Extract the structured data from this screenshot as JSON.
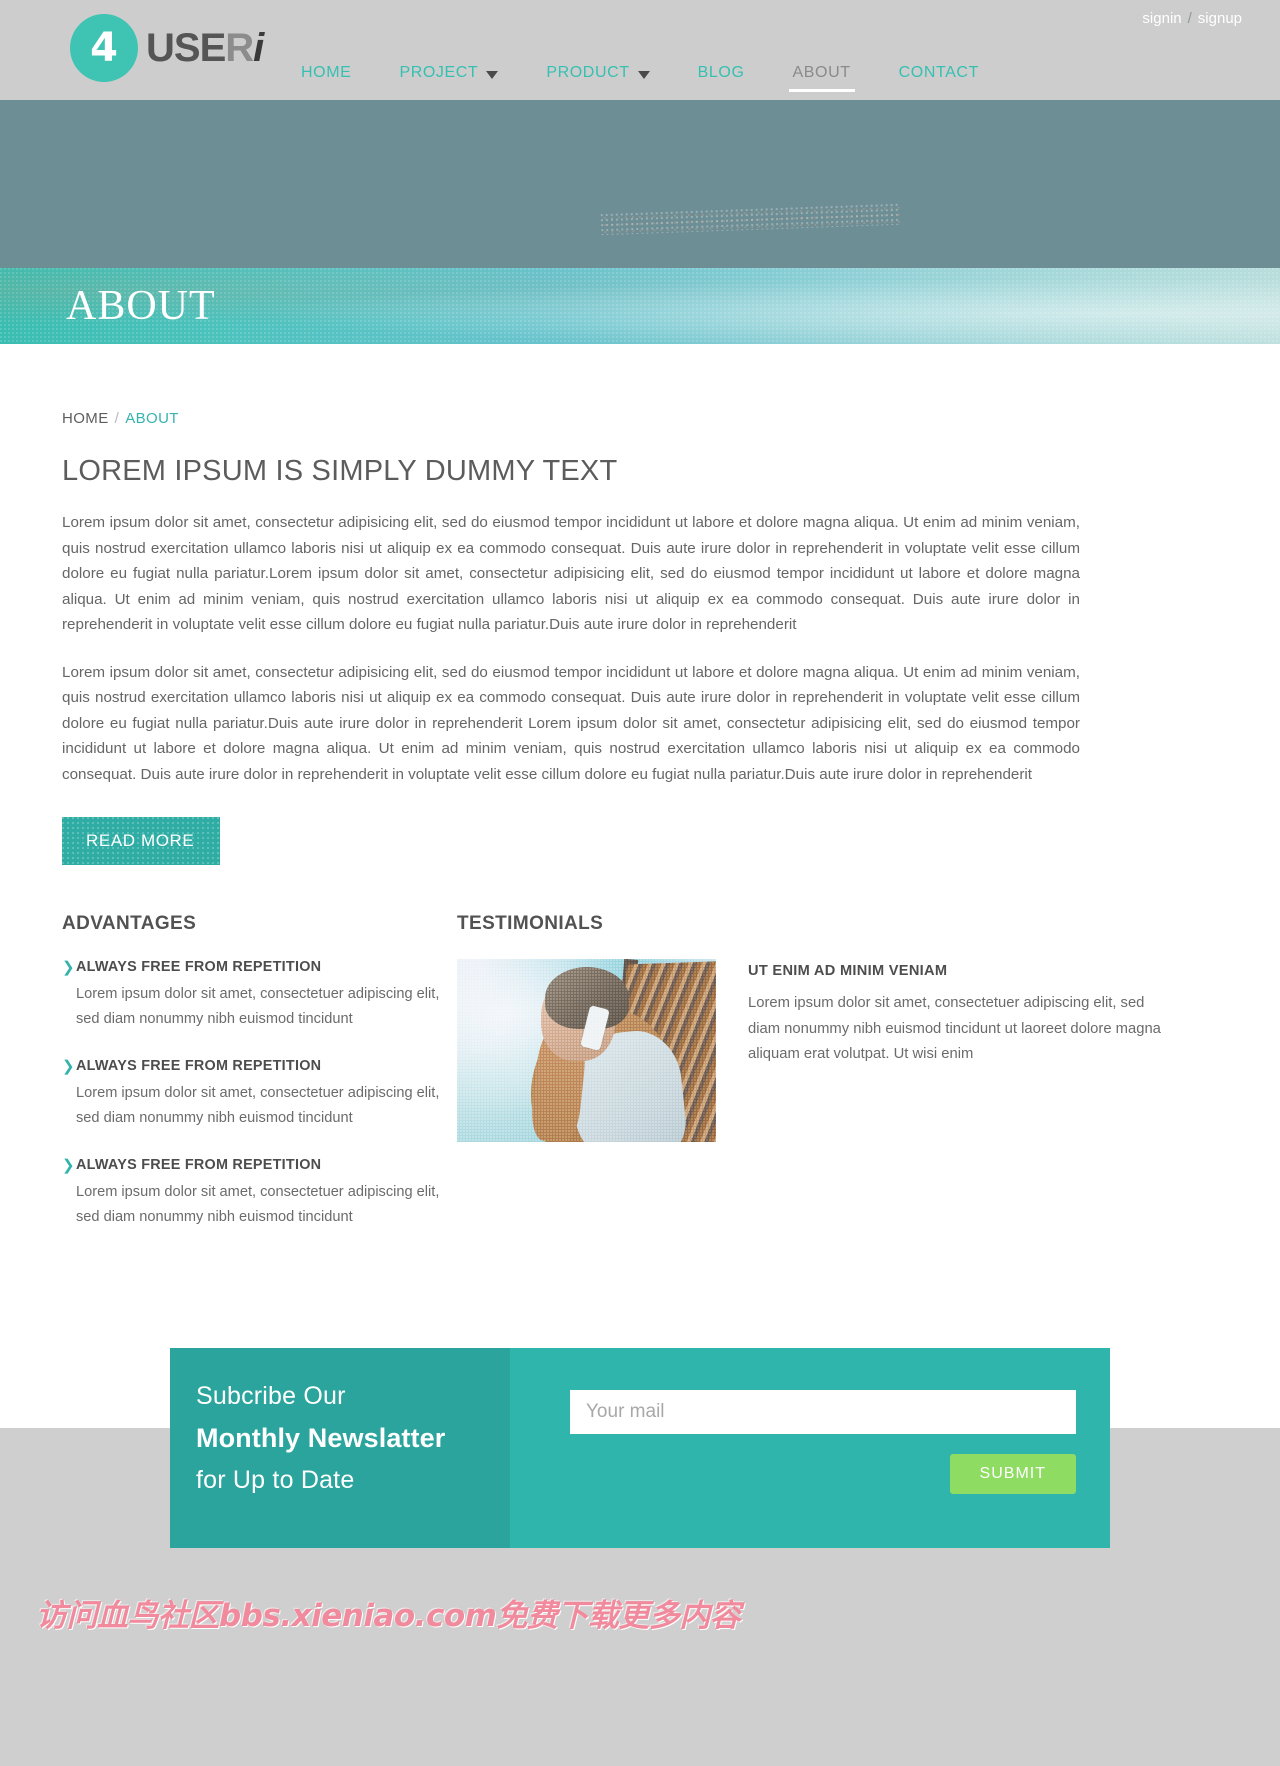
{
  "brand": {
    "mark": "4",
    "name_part1": "USE",
    "name_part2": "R",
    "name_part3": "i"
  },
  "auth": {
    "signin": "signin",
    "separator": "/",
    "signup": "signup"
  },
  "nav": {
    "items": [
      {
        "label": "HOME",
        "has_caret": false,
        "active": false
      },
      {
        "label": "PROJECT",
        "has_caret": true,
        "active": false
      },
      {
        "label": "PRODUCT",
        "has_caret": true,
        "active": false
      },
      {
        "label": "BLOG",
        "has_caret": false,
        "active": false
      },
      {
        "label": "ABOUT",
        "has_caret": false,
        "active": true
      },
      {
        "label": "CONTACT",
        "has_caret": false,
        "active": false
      }
    ]
  },
  "banner": {
    "title": "ABOUT"
  },
  "breadcrumb": {
    "home": "HOME",
    "separator": "/",
    "current": "ABOUT"
  },
  "page": {
    "heading": "LOREM IPSUM IS SIMPLY DUMMY TEXT",
    "paragraph1": "Lorem ipsum dolor sit amet, consectetur adipisicing elit, sed do eiusmod tempor incididunt ut labore et dolore magna aliqua. Ut enim ad minim veniam, quis nostrud exercitation ullamco laboris nisi ut aliquip ex ea commodo consequat. Duis aute irure dolor in reprehenderit in voluptate velit esse cillum dolore eu fugiat nulla pariatur.Lorem ipsum dolor sit amet, consectetur adipisicing elit, sed do eiusmod tempor incididunt ut labore et dolore magna aliqua. Ut enim ad minim veniam, quis nostrud exercitation ullamco laboris nisi ut aliquip ex ea commodo consequat. Duis aute irure dolor in reprehenderit in voluptate velit esse cillum dolore eu fugiat nulla pariatur.Duis aute irure dolor in reprehenderit",
    "paragraph2": "Lorem ipsum dolor sit amet, consectetur adipisicing elit, sed do eiusmod tempor incididunt ut labore et dolore magna aliqua. Ut enim ad minim veniam, quis nostrud exercitation ullamco laboris nisi ut aliquip ex ea commodo consequat. Duis aute irure dolor in reprehenderit in voluptate velit esse cillum dolore eu fugiat nulla pariatur.Duis aute irure dolor in reprehenderit Lorem ipsum dolor sit amet, consectetur adipisicing elit, sed do eiusmod tempor incididunt ut labore et dolore magna aliqua. Ut enim ad minim veniam, quis nostrud exercitation ullamco laboris nisi ut aliquip ex ea commodo consequat. Duis aute irure dolor in reprehenderit in voluptate velit esse cillum dolore eu fugiat nulla pariatur.Duis aute irure dolor in reprehenderit",
    "read_more": "READ MORE"
  },
  "advantages": {
    "heading": "ADVANTAGES",
    "items": [
      {
        "title": "ALWAYS FREE FROM REPETITION",
        "text": "Lorem ipsum dolor sit amet, consectetuer adipiscing elit, sed diam nonummy nibh euismod tincidunt"
      },
      {
        "title": "ALWAYS FREE FROM REPETITION",
        "text": "Lorem ipsum dolor sit amet, consectetuer adipiscing elit, sed diam nonummy nibh euismod tincidunt"
      },
      {
        "title": "ALWAYS FREE FROM REPETITION",
        "text": "Lorem ipsum dolor sit amet, consectetuer adipiscing elit, sed diam nonummy nibh euismod tincidunt"
      }
    ]
  },
  "testimonials": {
    "heading": "TESTIMONIALS",
    "title": "UT ENIM AD MINIM VENIAM",
    "text": "Lorem ipsum dolor sit amet, consectetuer adipiscing elit, sed diam nonummy nibh euismod tincidunt ut laoreet dolore magna aliquam erat volutpat. Ut wisi enim"
  },
  "newsletter": {
    "line1": "Subcribe Our",
    "line2": "Monthly Newslatter",
    "line3": "for Up to Date",
    "mail_placeholder": "Your mail",
    "mail_value": "",
    "submit_label": "SUBMIT"
  },
  "footer": {
    "watermark": "访问血鸟社区bbs.xieniao.com免费下载更多内容"
  },
  "colors": {
    "accent_teal": "#35c0b2",
    "accent_dark_teal": "#2aa49d",
    "newsletter_bg": "#2fb5ab",
    "submit_green": "#8fdc62",
    "page_bg": "#cfcfcf",
    "hero_bg": "#6d8e95",
    "watermark_pink": "#f08a9c"
  }
}
